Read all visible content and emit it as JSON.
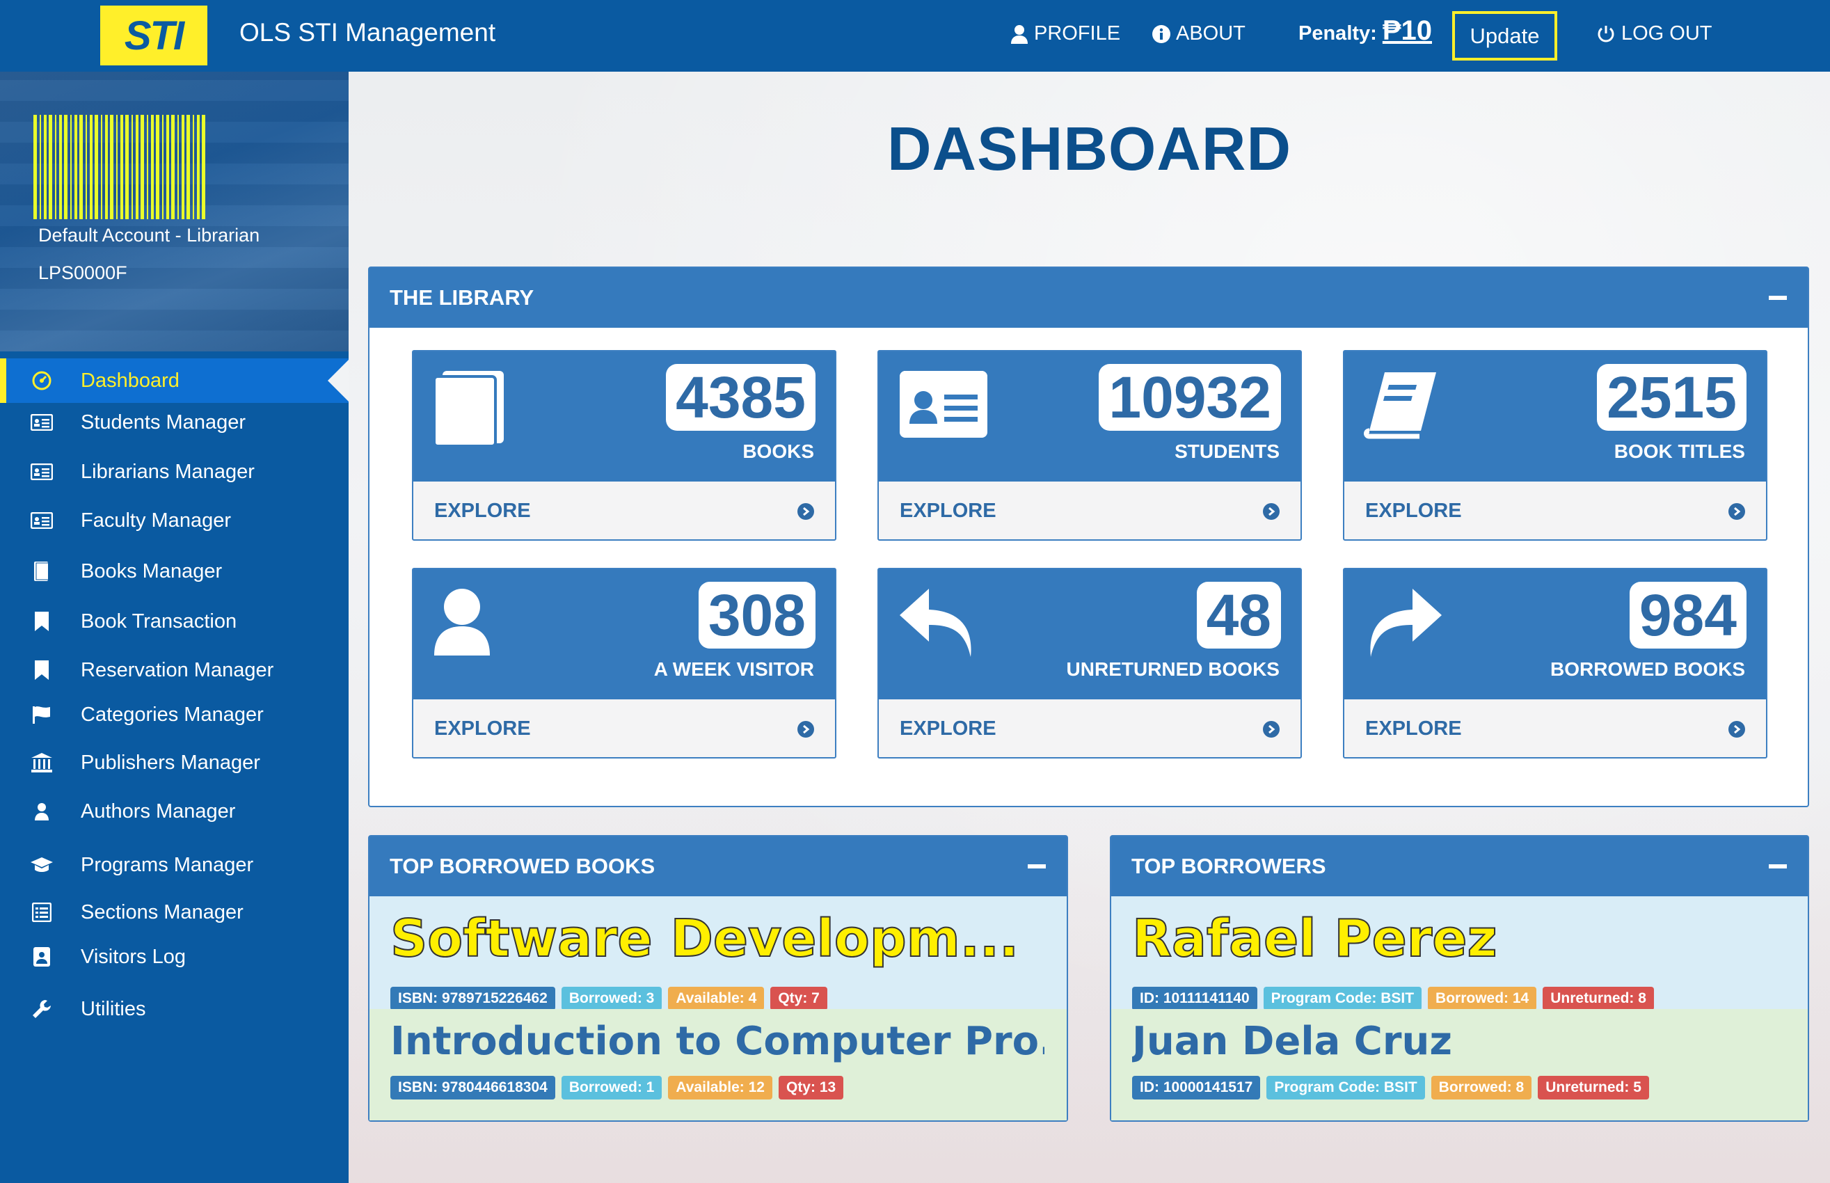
{
  "header": {
    "logo_text": "STI",
    "app_title": "OLS STI Management",
    "nav": {
      "profile": "PROFILE",
      "about": "ABOUT",
      "logout": "LOG OUT"
    },
    "penalty_label": "Penalty:",
    "penalty_value": "₱10",
    "update_label": "Update"
  },
  "sidebar": {
    "account_name": "Default Account - Librarian",
    "account_id": "LPS0000F",
    "items": [
      {
        "label": "Dashboard",
        "icon": "dashboard-icon"
      },
      {
        "label": "Students Manager",
        "icon": "id-card-icon"
      },
      {
        "label": "Librarians Manager",
        "icon": "id-card-icon"
      },
      {
        "label": "Faculty Manager",
        "icon": "id-card-icon"
      },
      {
        "label": "Books Manager",
        "icon": "book-icon"
      },
      {
        "label": "Book Transaction",
        "icon": "bookmark-icon"
      },
      {
        "label": "Reservation Manager",
        "icon": "bookmark-icon"
      },
      {
        "label": "Categories Manager",
        "icon": "flag-icon"
      },
      {
        "label": "Publishers Manager",
        "icon": "bank-icon"
      },
      {
        "label": "Authors Manager",
        "icon": "user-icon"
      },
      {
        "label": "Programs Manager",
        "icon": "graduation-cap-icon"
      },
      {
        "label": "Sections Manager",
        "icon": "list-icon"
      },
      {
        "label": "Visitors Log",
        "icon": "visitor-icon"
      },
      {
        "label": "Utilities",
        "icon": "wrench-icon"
      }
    ]
  },
  "main": {
    "title": "DASHBOARD",
    "library": {
      "title": "THE LIBRARY",
      "explore_label": "EXPLORE",
      "cards": [
        {
          "value": "4385",
          "label": "BOOKS",
          "icon": "book-icon"
        },
        {
          "value": "10932",
          "label": "STUDENTS",
          "icon": "id-card-icon"
        },
        {
          "value": "2515",
          "label": "BOOK TITLES",
          "icon": "book-open-icon"
        },
        {
          "value": "308",
          "label": "A WEEK VISITOR",
          "icon": "user-icon"
        },
        {
          "value": "48",
          "label": "UNRETURNED BOOKS",
          "icon": "reply-arrow-icon"
        },
        {
          "value": "984",
          "label": "BORROWED BOOKS",
          "icon": "share-arrow-icon"
        }
      ]
    },
    "top_books": {
      "title": "TOP BORROWED BOOKS",
      "items": [
        {
          "title": "Software Developm...",
          "isbn": "ISBN: 9789715226462",
          "borrowed": "Borrowed: 3",
          "available": "Available: 4",
          "qty": "Qty: 7"
        },
        {
          "title": "Introduction to Computer Pro...",
          "isbn": "ISBN: 9780446618304",
          "borrowed": "Borrowed: 1",
          "available": "Available: 12",
          "qty": "Qty: 13"
        }
      ]
    },
    "top_borrowers": {
      "title": "TOP BORROWERS",
      "items": [
        {
          "name": "Rafael Perez",
          "id": "ID: 10111141140",
          "program": "Program Code: BSIT",
          "borrowed": "Borrowed: 14",
          "unreturned": "Unreturned: 8"
        },
        {
          "name": "Juan Dela Cruz",
          "id": "ID: 10000141517",
          "program": "Program Code: BSIT",
          "borrowed": "Borrowed: 8",
          "unreturned": "Unreturned: 5"
        }
      ]
    }
  }
}
